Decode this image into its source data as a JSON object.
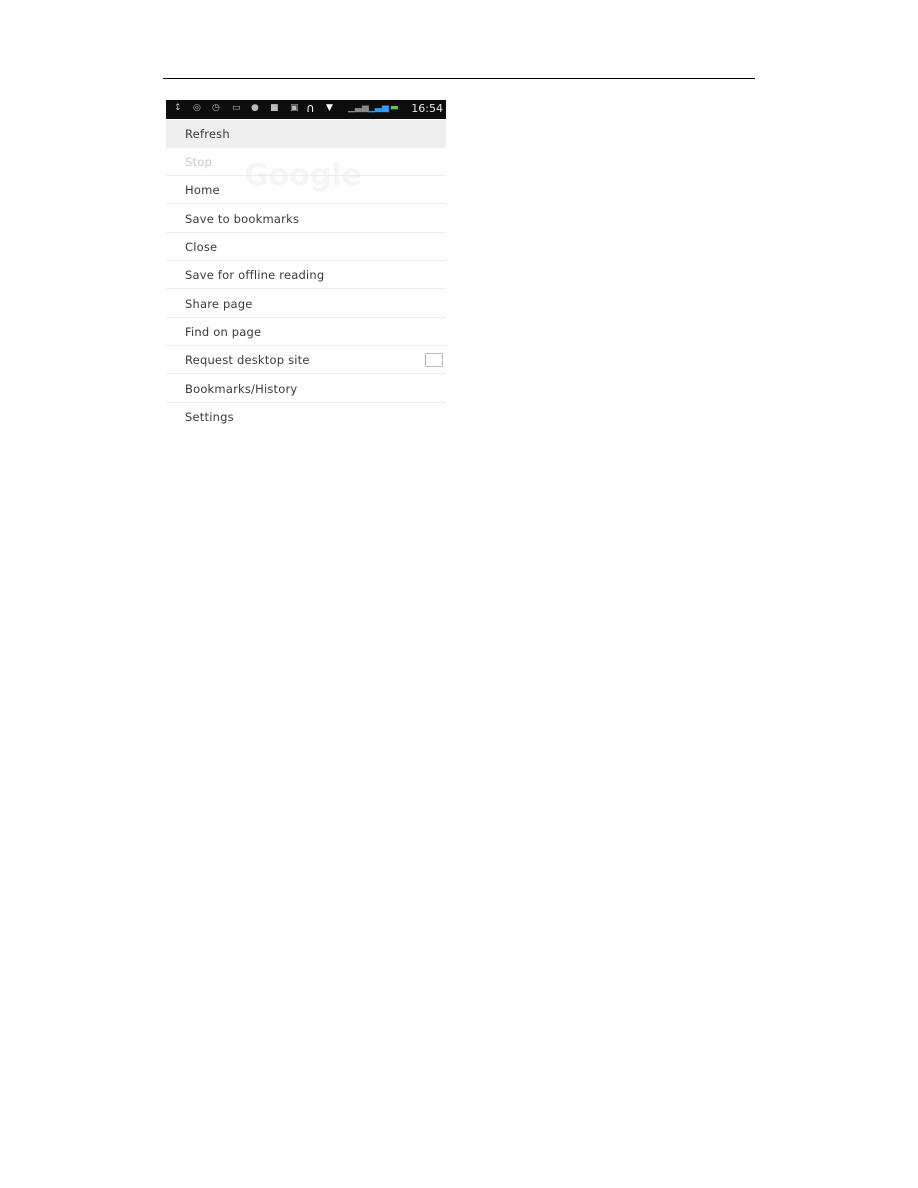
{
  "status_bar": {
    "time": "16:54",
    "icons": [
      "usb-icon",
      "sync-icon",
      "clock-icon",
      "image-icon",
      "record-icon",
      "lock-icon",
      "bluetooth-icon",
      "headset-icon",
      "wifi-icon",
      "signal-icon",
      "signal-icon",
      "battery-icon"
    ]
  },
  "background_logo": "Google",
  "menu": {
    "items": [
      {
        "label": "Refresh",
        "enabled": true
      },
      {
        "label": "Stop",
        "enabled": false
      },
      {
        "label": "Home",
        "enabled": true
      },
      {
        "label": "Save to bookmarks",
        "enabled": true
      },
      {
        "label": "Close",
        "enabled": true
      },
      {
        "label": "Save for offline reading",
        "enabled": true
      },
      {
        "label": "Share page",
        "enabled": true
      },
      {
        "label": "Find on page",
        "enabled": true
      },
      {
        "label": "Request desktop site",
        "enabled": true,
        "checkbox": false
      },
      {
        "label": "Bookmarks/History",
        "enabled": true
      },
      {
        "label": "Settings",
        "enabled": true
      }
    ]
  }
}
